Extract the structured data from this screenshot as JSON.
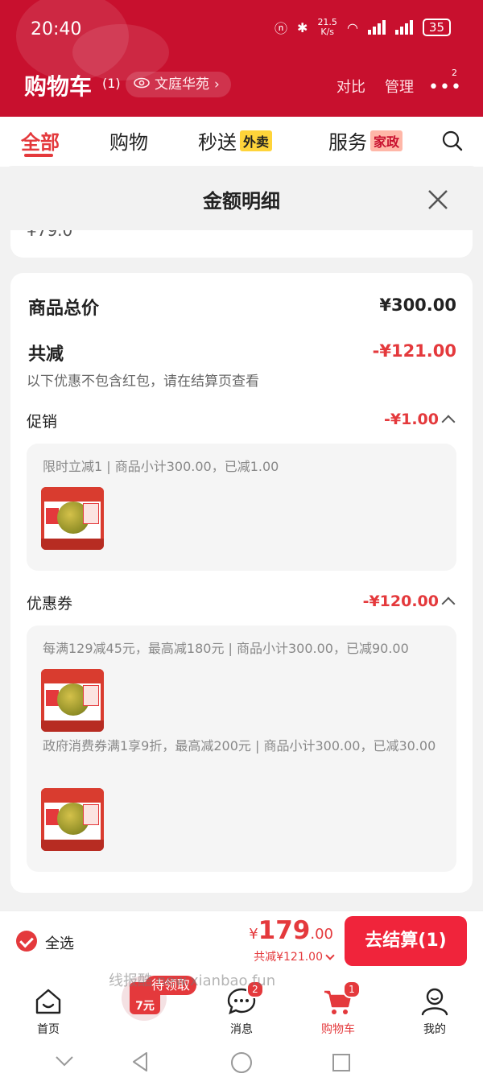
{
  "status": {
    "time": "20:40",
    "net_speed_top": "21.5",
    "net_speed_unit": "K/s",
    "battery": "35"
  },
  "header": {
    "title": "购物车",
    "count": "(1)",
    "address": "文庭华苑",
    "compare": "对比",
    "manage": "管理",
    "more_badge": "2"
  },
  "tabs": [
    {
      "label": "全部"
    },
    {
      "label": "购物"
    },
    {
      "label": "秒送",
      "tag": "外卖"
    },
    {
      "label": "服务",
      "tag": "家政"
    }
  ],
  "sheet": {
    "title": "金额明细",
    "cut_text": "¥79.0",
    "total_label": "商品总价",
    "total_value": "¥300.00",
    "discount_label": "共减",
    "discount_value": "-¥121.00",
    "note": "以下优惠不包含红包，请在结算页查看",
    "promo": {
      "label": "促销",
      "value": "-¥1.00",
      "items": [
        {
          "text": "限时立减1 | 商品小计300.00，已减1.00"
        }
      ]
    },
    "coupon": {
      "label": "优惠券",
      "value": "-¥120.00",
      "items": [
        {
          "text": "每满129减45元，最高减180元 | 商品小计300.00，已减90.00"
        },
        {
          "text": "政府消费券满1享9折，最高减200元 | 商品小计300.00，已减30.00"
        }
      ]
    }
  },
  "bottom": {
    "select_all": "全选",
    "price_symbol": "¥",
    "price_int": "179",
    "price_dec": ".00",
    "price_sub": "共减¥121.00",
    "checkout": "去结算(1)"
  },
  "promo_pill": {
    "label": "待领取",
    "amount": "7元"
  },
  "watermark": "线报酷 new.xianbao.fun",
  "nav": [
    {
      "label": "首页"
    },
    {
      "label": "消息",
      "badge": "2"
    },
    {
      "label": "购物车",
      "badge": "1"
    },
    {
      "label": "我的"
    }
  ],
  "colors": {
    "brand_red": "#c8102e",
    "accent_red": "#e4393c",
    "checkout_red": "#f0243b"
  }
}
